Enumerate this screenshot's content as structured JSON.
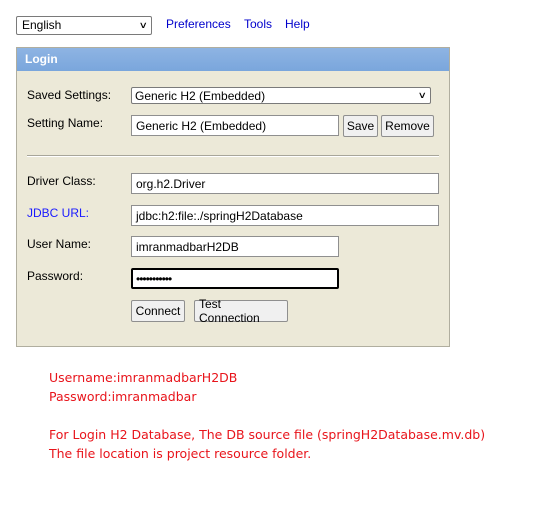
{
  "top": {
    "language": "English",
    "links": [
      "Preferences",
      "Tools",
      "Help"
    ]
  },
  "panel": {
    "title": "Login",
    "saved_settings_label": "Saved Settings:",
    "saved_settings_value": "Generic H2 (Embedded)",
    "setting_name_label": "Setting Name:",
    "setting_name_value": "Generic H2 (Embedded)",
    "save_button": "Save",
    "remove_button": "Remove",
    "driver_class_label": "Driver Class:",
    "driver_class_value": "org.h2.Driver",
    "jdbc_url_label": "JDBC URL:",
    "jdbc_url_value": "jdbc:h2:file:./springH2Database",
    "user_name_label": "User Name:",
    "user_name_value": "imranmadbarH2DB",
    "password_label": "Password:",
    "password_value": "•••••••••••",
    "connect_button": "Connect",
    "test_connection_button": "Test Connection"
  },
  "notes": {
    "username": "Username:imranmadbarH2DB",
    "password": "Password:imranmadbar",
    "line1": "For Login H2 Database, The DB source file (springH2Database.mv.db)",
    "line2": "The file location is project resource folder."
  }
}
